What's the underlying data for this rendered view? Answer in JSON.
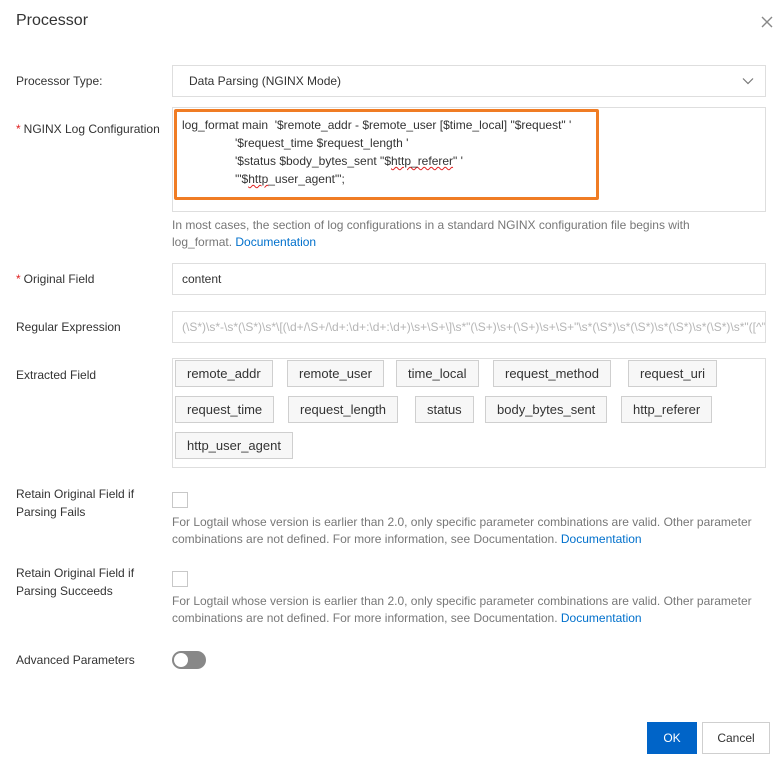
{
  "dialog": {
    "title": "Processor",
    "close_icon": "close-icon"
  },
  "processor_type": {
    "label": "Processor Type:",
    "value": "Data Parsing (NGINX Mode)",
    "icon": "chevron-down-icon"
  },
  "nginx_config": {
    "required_mark": "*",
    "label": "NGINX Log Configuration",
    "lines": [
      "log_format main  '$remote_addr - $remote_user [$time_local] \"$request\" '",
      "'$request_time $request_length '",
      "'$status $body_bytes_sent \"$http_referer\" '",
      "'\"$http_user_agent\"';"
    ],
    "help_text": "In most cases, the section of log configurations in a standard NGINX configuration file begins with log_format.",
    "help_link": "Documentation",
    "highlight_color": "#f07c24"
  },
  "original_field": {
    "required_mark": "*",
    "label": "Original Field",
    "value": "content"
  },
  "regex": {
    "label": "Regular Expression",
    "value": "(\\S*)\\s*-\\s*(\\S*)\\s*\\[(\\d+/\\S+/\\d+:\\d+:\\d+:\\d+)\\s+\\S+\\]\\s*\"(\\S+)\\s+(\\S+)\\s+\\S+\"\\s*(\\S*)\\s*(\\S*)\\s*(\\S*)\\s*(\\S*)\\s*\"([^\"]*)\"\\s*\"([^\"]*)\".*"
  },
  "extracted_field": {
    "label": "Extracted Field",
    "tags": [
      "remote_addr",
      "remote_user",
      "time_local",
      "request_method",
      "request_uri",
      "request_time",
      "request_length",
      "status",
      "body_bytes_sent",
      "http_referer",
      "http_user_agent"
    ]
  },
  "retain_fail": {
    "label_line1": "Retain Original Field if",
    "label_line2": "Parsing Fails",
    "help_line1": "For Logtail whose version is earlier than 2.0, only specific parameter combinations are valid. Other parameter",
    "help_line2": "combinations are not defined. For more information, see Documentation.",
    "help_link": "Documentation"
  },
  "retain_success": {
    "label_line1": "Retain Original Field if",
    "label_line2": "Parsing Succeeds",
    "help_line1": "For Logtail whose version is earlier than 2.0, only specific parameter combinations are valid. Other parameter",
    "help_line2": "combinations are not defined. For more information, see Documentation.",
    "help_link": "Documentation"
  },
  "advanced": {
    "label": "Advanced Parameters",
    "enabled": false
  },
  "footer": {
    "ok_label": "OK",
    "cancel_label": "Cancel",
    "primary_color": "#0064c8"
  }
}
